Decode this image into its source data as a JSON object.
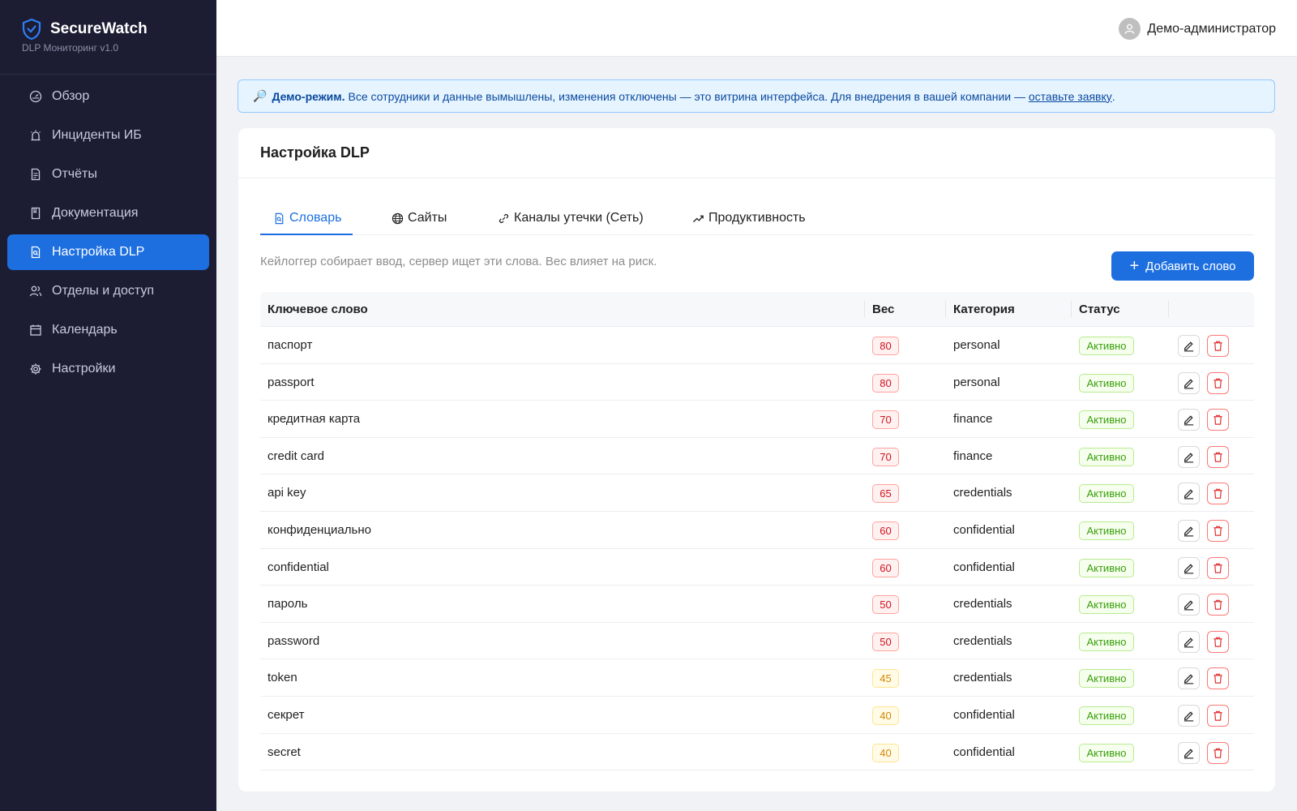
{
  "brand": {
    "title": "SecureWatch",
    "subtitle": "DLP Мониторинг v1.0",
    "logo_icon": "shield-check-icon",
    "accent": "#1d6fe0"
  },
  "sidebar": {
    "items": [
      {
        "label": "Обзор",
        "icon": "dashboard-icon",
        "active": false
      },
      {
        "label": "Инциденты ИБ",
        "icon": "alarm-icon",
        "active": false
      },
      {
        "label": "Отчёты",
        "icon": "file-text-icon",
        "active": false
      },
      {
        "label": "Документация",
        "icon": "book-icon",
        "active": false
      },
      {
        "label": "Настройка DLP",
        "icon": "file-search-icon",
        "active": true
      },
      {
        "label": "Отделы и доступ",
        "icon": "users-icon",
        "active": false
      },
      {
        "label": "Календарь",
        "icon": "calendar-icon",
        "active": false
      },
      {
        "label": "Настройки",
        "icon": "gear-icon",
        "active": false
      }
    ]
  },
  "header": {
    "user_name": "Демо-администратор",
    "avatar_icon": "user-icon"
  },
  "banner": {
    "icon": "🔎",
    "bold": "Демо-режим.",
    "text": "Все сотрудники и данные вымышлены, изменения отключены — это витрина интерфейса. Для внедрения в вашей компании —",
    "link": "оставьте заявку",
    "tail": "."
  },
  "page": {
    "title": "Настройка DLP"
  },
  "tabs": [
    {
      "label": "Словарь",
      "icon": "file-search-icon",
      "active": true
    },
    {
      "label": "Сайты",
      "icon": "globe-icon",
      "active": false
    },
    {
      "label": "Каналы утечки (Сеть)",
      "icon": "link-icon",
      "active": false
    },
    {
      "label": "Продуктивность",
      "icon": "trend-up-icon",
      "active": false
    }
  ],
  "dictionary": {
    "hint": "Кейлоггер собирает ввод, сервер ищет эти слова. Вес влияет на риск.",
    "add_button": "Добавить слово",
    "columns": [
      "Ключевое слово",
      "Вес",
      "Категория",
      "Статус"
    ],
    "rows": [
      {
        "word": "паспорт",
        "weight": "80",
        "category": "personal",
        "status": "Активно",
        "level": "red"
      },
      {
        "word": "passport",
        "weight": "80",
        "category": "personal",
        "status": "Активно",
        "level": "red"
      },
      {
        "word": "кредитная карта",
        "weight": "70",
        "category": "finance",
        "status": "Активно",
        "level": "red"
      },
      {
        "word": "credit card",
        "weight": "70",
        "category": "finance",
        "status": "Активно",
        "level": "red"
      },
      {
        "word": "api key",
        "weight": "65",
        "category": "credentials",
        "status": "Активно",
        "level": "red"
      },
      {
        "word": "конфиденциально",
        "weight": "60",
        "category": "confidential",
        "status": "Активно",
        "level": "red"
      },
      {
        "word": "confidential",
        "weight": "60",
        "category": "confidential",
        "status": "Активно",
        "level": "red"
      },
      {
        "word": "пароль",
        "weight": "50",
        "category": "credentials",
        "status": "Активно",
        "level": "red"
      },
      {
        "word": "password",
        "weight": "50",
        "category": "credentials",
        "status": "Активно",
        "level": "red"
      },
      {
        "word": "token",
        "weight": "45",
        "category": "credentials",
        "status": "Активно",
        "level": "orange"
      },
      {
        "word": "секрет",
        "weight": "40",
        "category": "confidential",
        "status": "Активно",
        "level": "orange"
      },
      {
        "word": "secret",
        "weight": "40",
        "category": "confidential",
        "status": "Активно",
        "level": "orange"
      }
    ]
  },
  "colors": {
    "sidebar_bg": "#1c1d33",
    "weight_high": "#cf1322",
    "weight_mid": "#d48806",
    "status_active": "#389e0d"
  }
}
